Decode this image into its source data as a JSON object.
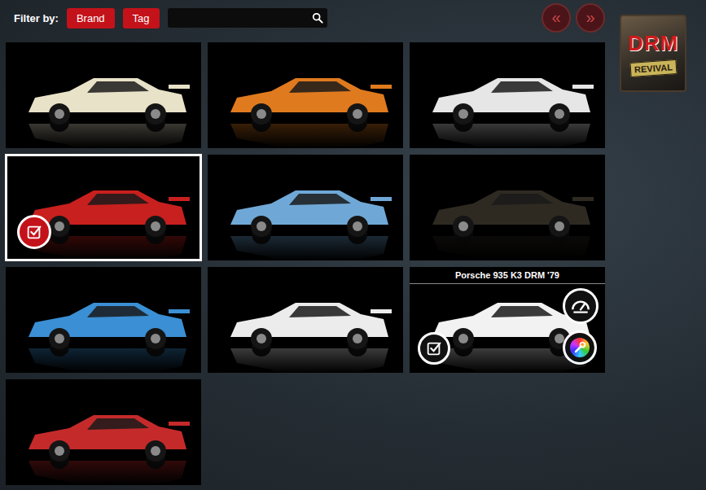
{
  "filter": {
    "label": "Filter by:",
    "buttons": [
      "Brand",
      "Tag"
    ]
  },
  "search": {
    "value": ""
  },
  "pager": [
    "«",
    "»"
  ],
  "logo": {
    "title": "DRM",
    "subtitle": "REVIVAL"
  },
  "cars": [
    {
      "color": "#e8e2c8",
      "selected": false,
      "hovered": false
    },
    {
      "color": "#e07a1e",
      "selected": false,
      "hovered": false
    },
    {
      "color": "#e6e6e6",
      "selected": false,
      "hovered": false
    },
    {
      "color": "#c8201e",
      "selected": true,
      "hovered": false
    },
    {
      "color": "#6fa8d6",
      "selected": false,
      "hovered": false
    },
    {
      "color": "#2e2a22",
      "selected": false,
      "hovered": false
    },
    {
      "color": "#3b8fd4",
      "selected": false,
      "hovered": false
    },
    {
      "color": "#ececec",
      "selected": false,
      "hovered": false
    },
    {
      "color": "#f2f2f2",
      "selected": false,
      "hovered": true,
      "title": "Porsche 935 K3 DRM '79"
    },
    {
      "color": "#c52a2a",
      "selected": false,
      "hovered": false
    }
  ]
}
